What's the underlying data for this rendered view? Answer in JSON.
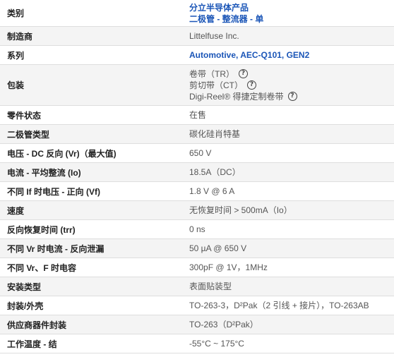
{
  "rows": [
    {
      "label": "类别",
      "values": [
        "分立半导体产品",
        "二极管 - 整流器 - 单"
      ],
      "link": true
    },
    {
      "label": "制造商",
      "values": [
        "Littelfuse Inc."
      ]
    },
    {
      "label": "系列",
      "values": [
        "Automotive, AEC-Q101, GEN2"
      ],
      "link": true
    },
    {
      "label": "包装",
      "values": [
        "卷带（TR）",
        "剪切带（CT）",
        "Digi-Reel® 得捷定制卷带"
      ],
      "help": true
    },
    {
      "label": "零件状态",
      "values": [
        "在售"
      ]
    },
    {
      "label": "二极管类型",
      "values": [
        "碳化硅肖特基"
      ]
    },
    {
      "label": "电压 - DC 反向 (Vr)（最大值)",
      "values": [
        "650 V"
      ]
    },
    {
      "label": "电流 - 平均整流 (Io)",
      "values": [
        "18.5A（DC）"
      ]
    },
    {
      "label": "不同 If 时电压 - 正向 (Vf)",
      "values": [
        "1.8 V @ 6 A"
      ]
    },
    {
      "label": "速度",
      "values": [
        "无恢复时间 > 500mA（Io）"
      ]
    },
    {
      "label": "反向恢复时间 (trr)",
      "values": [
        "0 ns"
      ]
    },
    {
      "label": "不同 Vr 时电流 - 反向泄漏",
      "values": [
        "50 µA @ 650 V"
      ]
    },
    {
      "label": "不同 Vr、F 时电容",
      "values": [
        "300pF @ 1V，1MHz"
      ]
    },
    {
      "label": "安装类型",
      "values": [
        "表面贴装型"
      ]
    },
    {
      "label": "封装/外壳",
      "values": [
        "TO-263-3，D²Pak（2 引线 + 接片），TO-263AB"
      ]
    },
    {
      "label": "供应商器件封装",
      "values": [
        "TO-263（D²Pak）"
      ]
    },
    {
      "label": "工作温度 - 结",
      "values": [
        "-55°C ~ 175°C"
      ]
    }
  ],
  "help_icon": "question-circle-icon",
  "colors": {
    "link": "#1a55b7",
    "row_alt": "#f4f4f4",
    "border": "#dedede"
  }
}
